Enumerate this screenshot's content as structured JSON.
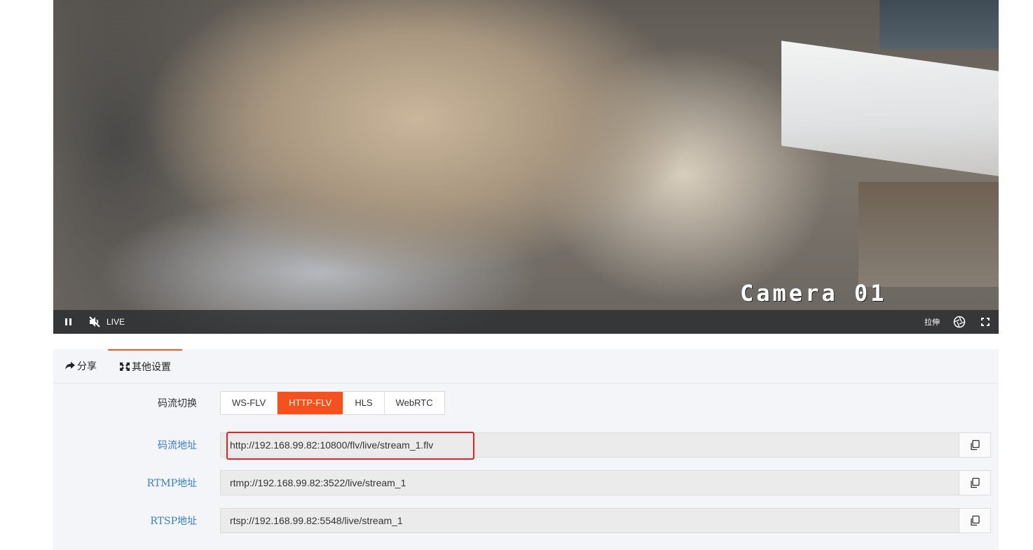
{
  "video": {
    "osd_label": "Camera 01",
    "live_label": "LIVE",
    "stretch_label": "拉伸",
    "icons": [
      "pause-icon",
      "mute-icon",
      "snapshot-icon",
      "fullscreen-icon"
    ]
  },
  "tabs": [
    {
      "label": "分享",
      "icon": "share-icon"
    },
    {
      "label": "其他设置",
      "icon": "expand-icon",
      "active": true
    }
  ],
  "stream_switch": {
    "label": "码流切换",
    "options": [
      "WS-FLV",
      "HTTP-FLV",
      "HLS",
      "WebRTC"
    ],
    "selected": "HTTP-FLV"
  },
  "addresses": [
    {
      "label": "码流地址",
      "value": "http://192.168.99.82:10800/flv/live/stream_1.flv",
      "highlighted": true
    },
    {
      "label": "RTMP地址",
      "value": "rtmp://192.168.99.82:3522/live/stream_1"
    },
    {
      "label": "RTSP地址",
      "value": "rtsp://192.168.99.82:5548/live/stream_1"
    }
  ],
  "colors": {
    "accent": "#f4511e",
    "label_blue": "#3a7cc2",
    "highlight_red": "#e0251e"
  }
}
